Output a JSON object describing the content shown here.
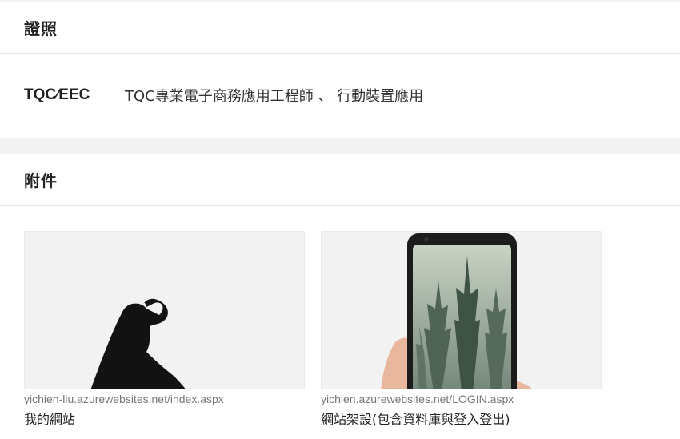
{
  "certificates": {
    "title": "證照",
    "items": [
      {
        "code": "TQC∕EEC",
        "description": "TQC專業電子商務應用工程師 、 行動裝置應用"
      }
    ]
  },
  "attachments": {
    "title": "附件",
    "items": [
      {
        "url": "yichien-liu.azurewebsites.net/index.aspx",
        "title": "我的網站"
      },
      {
        "url": "yichien.azurewebsites.net/LOGIN.aspx",
        "title": "網站架設(包含資料庫與登入登出)"
      }
    ]
  }
}
